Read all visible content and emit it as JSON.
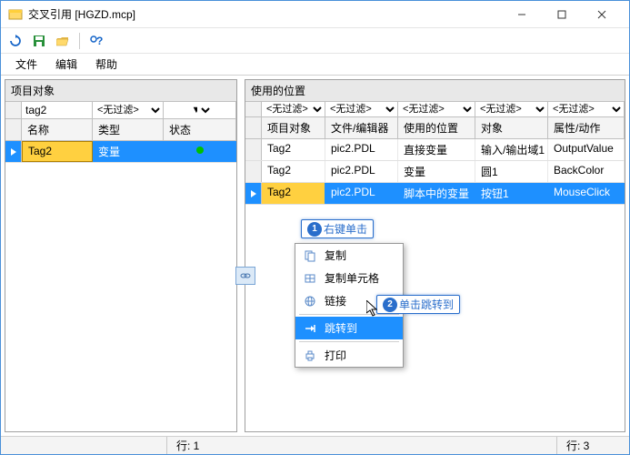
{
  "title": "交叉引用 [HGZD.mcp]",
  "toolbar": {
    "refresh": "↻",
    "save": "💾",
    "open": "📁",
    "help": "?"
  },
  "menu": {
    "file": "文件",
    "edit": "编辑",
    "help": "帮助"
  },
  "left": {
    "header": "项目对象",
    "filters": {
      "name": "tag2",
      "type": "<无过滤>"
    },
    "headers": {
      "name": "名称",
      "type": "类型",
      "status": "状态"
    },
    "row": {
      "name": "Tag2",
      "type": "变量"
    }
  },
  "right": {
    "header": "使用的位置",
    "filters": {
      "f1": "<无过滤>",
      "f2": "<无过滤>",
      "f3": "<无过滤>",
      "f4": "<无过滤>",
      "f5": "<无过滤>"
    },
    "headers": {
      "obj": "项目对象",
      "file": "文件/编辑器",
      "loc": "使用的位置",
      "target": "对象",
      "attr": "属性/动作"
    },
    "rows": [
      {
        "obj": "Tag2",
        "file": "pic2.PDL",
        "loc": "直接变量",
        "target": "输入/输出域1",
        "attr": "OutputValue"
      },
      {
        "obj": "Tag2",
        "file": "pic2.PDL",
        "loc": "变量",
        "target": "圆1",
        "attr": "BackColor"
      },
      {
        "obj": "Tag2",
        "file": "pic2.PDL",
        "loc": "脚本中的变量",
        "target": "按钮1",
        "attr": "MouseClick"
      }
    ]
  },
  "contextMenu": {
    "copy": "复制",
    "copyCell": "复制单元格",
    "link": "链接",
    "goto": "跳转到",
    "print": "打印"
  },
  "callout1": "右键单击",
  "callout2": "单击跳转到",
  "status": {
    "left": "行: 1",
    "right": "行: 3"
  }
}
